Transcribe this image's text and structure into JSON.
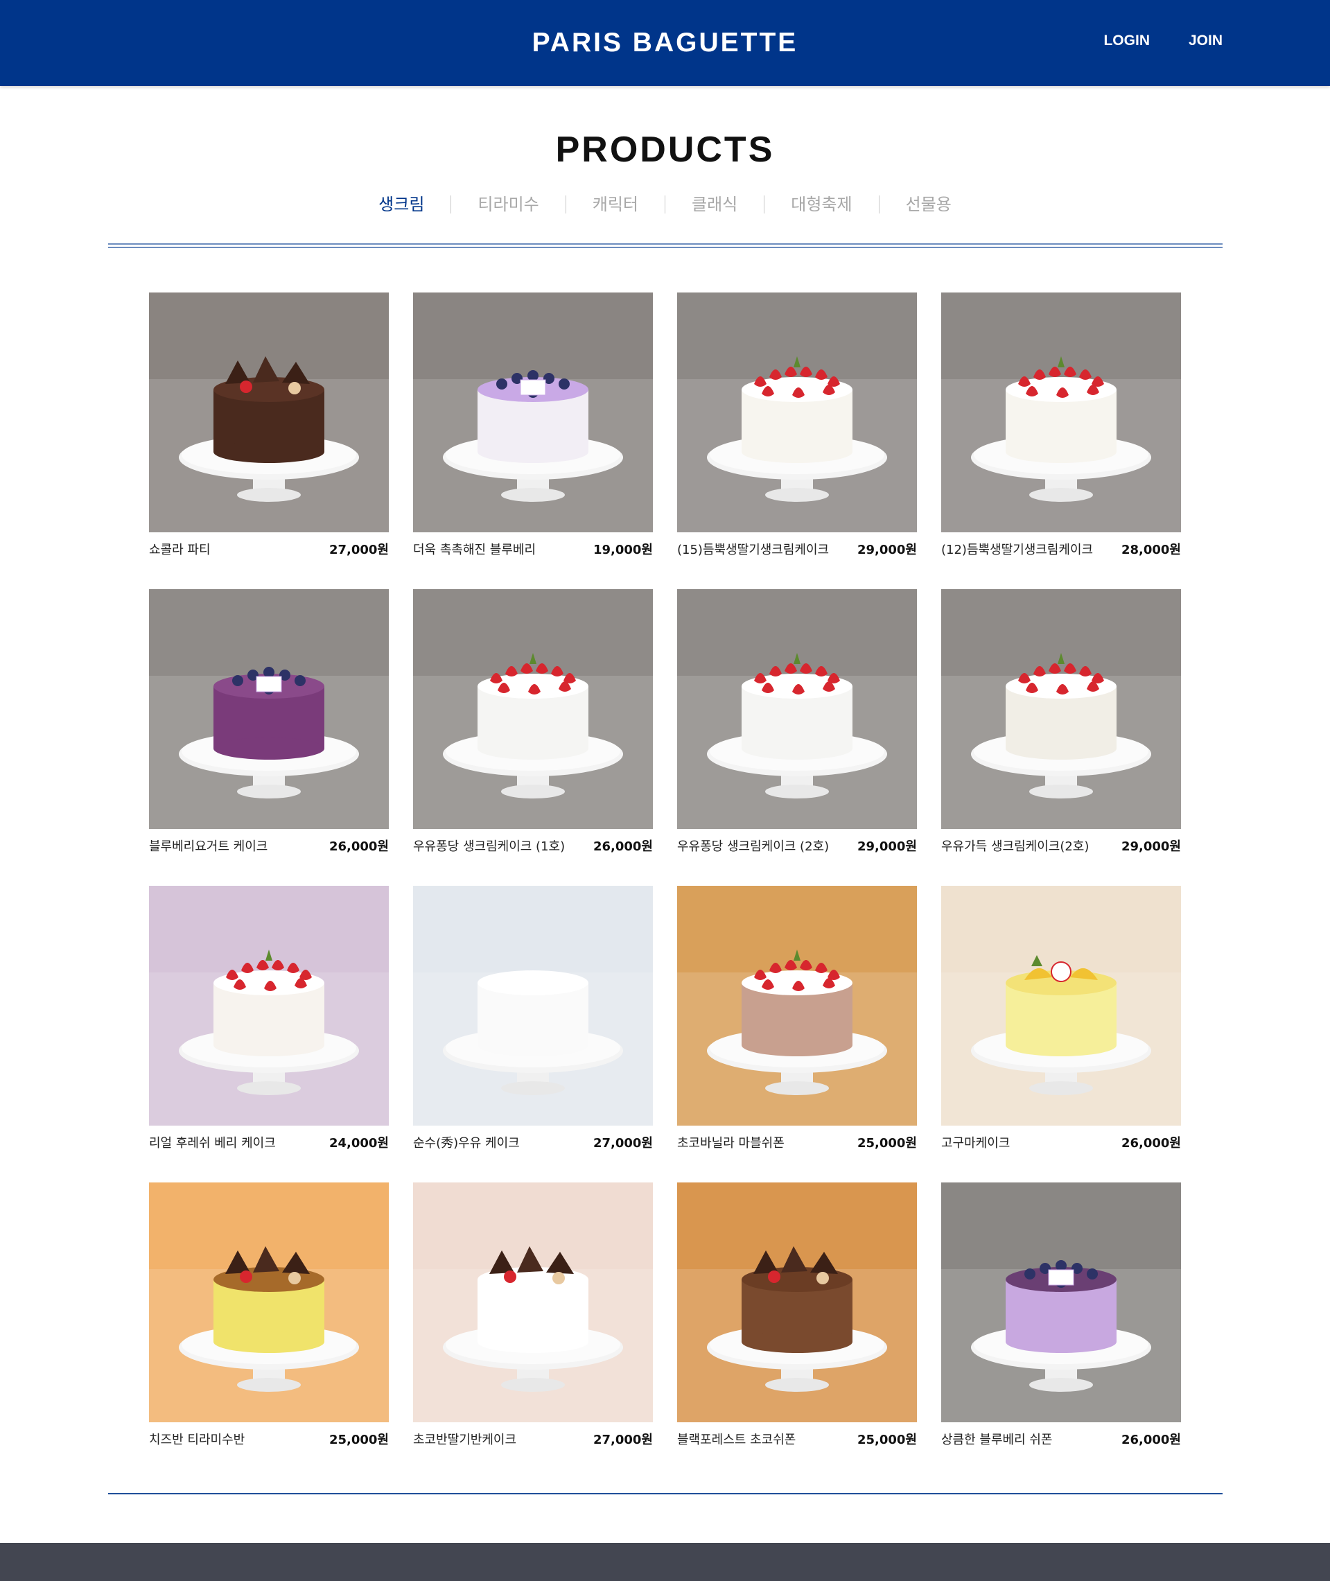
{
  "header": {
    "logo": "PARIS BAGUETTE",
    "login": "LOGIN",
    "join": "JOIN"
  },
  "page": {
    "title": "PRODUCTS"
  },
  "tabs": [
    {
      "label": "생크림",
      "active": true
    },
    {
      "label": "티라미수",
      "active": false
    },
    {
      "label": "캐릭터",
      "active": false
    },
    {
      "label": "클래식",
      "active": false
    },
    {
      "label": "대형축제",
      "active": false
    },
    {
      "label": "선물용",
      "active": false
    }
  ],
  "products": [
    {
      "name": "쇼콜라 파티",
      "price": "27,000원",
      "bg": "#8a8480",
      "cake": "#4a2a1e",
      "top": "#5a3325",
      "deco": "chocolate"
    },
    {
      "name": "더욱 촉촉해진 블루베리",
      "price": "19,000원",
      "bg": "#8a8582",
      "cake": "#f2eef5",
      "top": "#c9a9e6",
      "deco": "berry"
    },
    {
      "name": "(15)듬뿍생딸기생크림케이크",
      "price": "29,000원",
      "bg": "#8d8986",
      "cake": "#f7f5ef",
      "top": "#ffffff",
      "deco": "strawberry"
    },
    {
      "name": "(12)듬뿍생딸기생크림케이크",
      "price": "28,000원",
      "bg": "#8d8986",
      "cake": "#f7f5ef",
      "top": "#ffffff",
      "deco": "strawberry"
    },
    {
      "name": "블루베리요거트 케이크",
      "price": "26,000원",
      "bg": "#8f8b88",
      "cake": "#7a3b7a",
      "top": "#8a4a8a",
      "deco": "berry"
    },
    {
      "name": "우유퐁당 생크림케이크 (1호)",
      "price": "26,000원",
      "bg": "#8f8b88",
      "cake": "#f5f5f3",
      "top": "#ffffff",
      "deco": "strawberry"
    },
    {
      "name": "우유퐁당 생크림케이크 (2호)",
      "price": "29,000원",
      "bg": "#8f8b88",
      "cake": "#f5f5f3",
      "top": "#ffffff",
      "deco": "strawberry"
    },
    {
      "name": "우유가득 생크림케이크(2호)",
      "price": "29,000원",
      "bg": "#8f8b88",
      "cake": "#f1eee6",
      "top": "#ffffff",
      "deco": "strawberry"
    },
    {
      "name": "리얼 후레쉬 베리 케이크",
      "price": "24,000원",
      "bg": "#d6c4d9",
      "cake": "#f7f3ee",
      "top": "#ffffff",
      "deco": "strawberry"
    },
    {
      "name": "순수(秀)우유 케이크",
      "price": "27,000원",
      "bg": "#e3e8ee",
      "cake": "#fafafa",
      "top": "#ffffff",
      "deco": "none"
    },
    {
      "name": "초코바닐라 마블쉬폰",
      "price": "25,000원",
      "bg": "#d9a05a",
      "cake": "#c8a08f",
      "top": "#ffffff",
      "deco": "strawberry"
    },
    {
      "name": "고구마케이크",
      "price": "26,000원",
      "bg": "#efe1cf",
      "cake": "#f6ef9a",
      "top": "#f3e277",
      "deco": "fruit"
    },
    {
      "name": "치즈반 티라미수반",
      "price": "25,000원",
      "bg": "#f2b26b",
      "cake": "#f0e36b",
      "top": "#a66a2a",
      "deco": "chocolate"
    },
    {
      "name": "초코반딸기반케이크",
      "price": "27,000원",
      "bg": "#f0dcd2",
      "cake": "#ffffff",
      "top": "#ffffff",
      "deco": "chocolate"
    },
    {
      "name": "블랙포레스트 초코쉬폰",
      "price": "25,000원",
      "bg": "#d9964f",
      "cake": "#7a4a2e",
      "top": "#6b3d24",
      "deco": "chocolate"
    },
    {
      "name": "상큼한 블루베리 쉬폰",
      "price": "26,000원",
      "bg": "#8a8784",
      "cake": "#c8a8e0",
      "top": "#6a3f73",
      "deco": "berry"
    }
  ]
}
